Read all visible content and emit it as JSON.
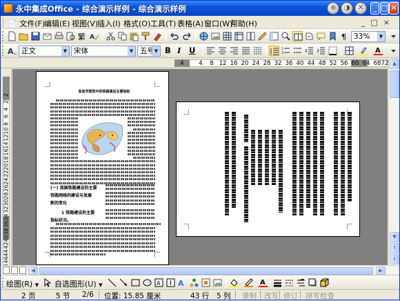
{
  "window": {
    "title": "永中集成Office - 综合演示样例 - 综合演示样例",
    "title_controls": [
      "⊕",
      "◑",
      "✕"
    ],
    "minimize": "_",
    "maximize": "□",
    "close": "✕"
  },
  "menu": {
    "items": [
      "文件(F)",
      "编辑(E)",
      "视图(V)",
      "插入(I)",
      "格式(O)",
      "工具(T)",
      "表格(A)",
      "窗口(W)",
      "帮助(H)"
    ],
    "doc_controls": "_□×"
  },
  "toolbar1": {
    "zoom": "33%",
    "zoom_arrow": "▼"
  },
  "toolbar2": {
    "style": "正文",
    "font": "宋体",
    "size": "五号",
    "bold": "B",
    "italic": "I",
    "underline": "U",
    "combo_arrow": "▼"
  },
  "hruler": {
    "ticks": [
      "4",
      "4",
      "8",
      "12",
      "16",
      "20",
      "24",
      "28",
      "32",
      "36",
      "40",
      "44",
      "48",
      "52",
      "56",
      "60",
      "64",
      "68",
      "72"
    ]
  },
  "vruler": {
    "ticks": [
      "2",
      "2",
      "4",
      "6",
      "8",
      "10",
      "12",
      "14",
      "16",
      "18",
      "20",
      "22",
      "24",
      "26",
      "28",
      "30",
      "32",
      "34",
      "36",
      "38",
      "40",
      "42",
      "44",
      "46",
      "48"
    ]
  },
  "document": {
    "page1_title": "各省市报告中的铁路建设主要指标",
    "page1_heading1": "(一) 我国铁路建设的主要",
    "page1_heading1_b": "铁路网络的建设与发展",
    "page1_heading1_c": "新的变化",
    "page1_heading2": "1  铁路建设的主要",
    "page1_heading2_b": "指标状况。"
  },
  "drawbar": {
    "draw_label": "绘图(R)",
    "autoshape_label": "自选图形(U)",
    "dropdown": "▼"
  },
  "status": {
    "page": "2 页",
    "section": "5 节",
    "page_of": "2/6",
    "position": "位置: 15.85 厘米",
    "line": "43 行",
    "column": "5 列",
    "rec": "录制",
    "trk": "改写",
    "ext": "修订",
    "spell": "拼写检查"
  },
  "scroll": {
    "up": "▲",
    "down": "▼",
    "left": "◀",
    "right": "▶"
  }
}
